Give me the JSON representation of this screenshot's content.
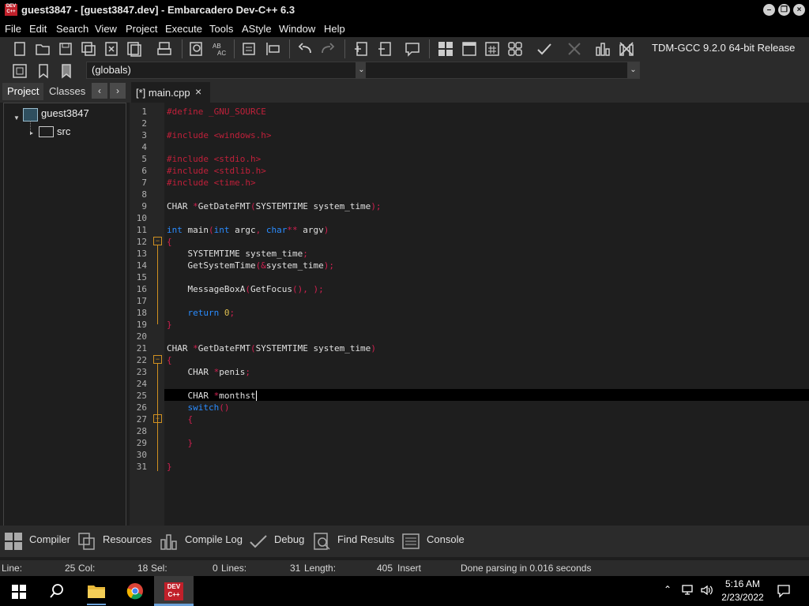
{
  "window": {
    "title": "guest3847 - [guest3847.dev] - Embarcadero Dev-C++ 6.3",
    "app_icon_text": "DEV C++"
  },
  "menu": [
    "File",
    "Edit",
    "Search",
    "View",
    "Project",
    "Execute",
    "Tools",
    "AStyle",
    "Window",
    "Help"
  ],
  "toolbar": {
    "compiler_select": "TDM-GCC 9.2.0 64-bit Release",
    "scope_select": "(globals)",
    "function_select": ""
  },
  "left_panel": {
    "tabs": [
      "Project",
      "Classes"
    ],
    "active_tab": "Project",
    "tree": {
      "root": "guest3847",
      "children": [
        "src"
      ]
    }
  },
  "editor": {
    "tab_label": "[*] main.cpp",
    "line_numbers": [
      "1",
      "2",
      "3",
      "4",
      "5",
      "6",
      "7",
      "8",
      "9",
      "10",
      "11",
      "12",
      "13",
      "14",
      "15",
      "16",
      "17",
      "18",
      "19",
      "20",
      "21",
      "22",
      "23",
      "24",
      "25",
      "26",
      "27",
      "28",
      "29",
      "30",
      "31"
    ]
  },
  "bottom_tabs": [
    "Compiler",
    "Resources",
    "Compile Log",
    "Debug",
    "Find Results",
    "Console"
  ],
  "status": {
    "line_label": "Line:",
    "line_value": "25",
    "col_label": "Col:",
    "col_value": "18",
    "sel_label": "Sel:",
    "sel_value": "0",
    "lines_label": "Lines:",
    "lines_value": "31",
    "length_label": "Length:",
    "length_value": "405",
    "mode": "Insert",
    "message": "Done parsing in 0.016 seconds"
  },
  "taskbar": {
    "time": "5:16 AM",
    "date": "2/23/2022",
    "devcpp_icon_text": "DEV C++"
  }
}
